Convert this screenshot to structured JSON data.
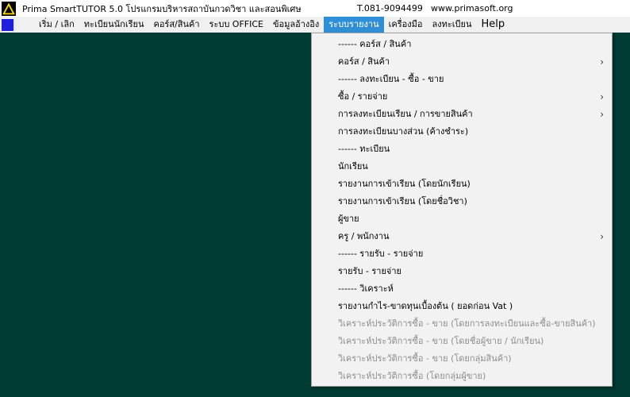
{
  "titlebar": {
    "title": "Prima  SmartTUTOR 5.0  โปรแกรมบริหารสถาบันกวดวิชา และสอนพิเศษ",
    "phone": "T.081-9094499",
    "website": "www.primasoft.org"
  },
  "menubar": {
    "items": [
      {
        "label": "เริ่ม / เลิก"
      },
      {
        "label": "ทะเบียนนักเรียน"
      },
      {
        "label": "คอร์ส/สินค้า"
      },
      {
        "label": "ระบบ OFFICE"
      },
      {
        "label": "ข้อมูลอ้างอิง"
      },
      {
        "label": "ระบบรายงาน"
      },
      {
        "label": "เครื่องมือ"
      },
      {
        "label": "ลงทะเบียน"
      },
      {
        "label": "Help"
      }
    ]
  },
  "dropdown": {
    "items": [
      {
        "label": "------  คอร์ส / สินค้า",
        "submenu": false,
        "disabled": false
      },
      {
        "label": "คอร์ส / สินค้า",
        "submenu": true,
        "disabled": false
      },
      {
        "label": "------  ลงทะเบียน - ซื้อ - ขาย",
        "submenu": false,
        "disabled": false
      },
      {
        "label": "ซื้อ / รายจ่าย",
        "submenu": true,
        "disabled": false
      },
      {
        "label": "การลงทะเบียนเรียน / การขายสินค้า",
        "submenu": true,
        "disabled": false
      },
      {
        "label": "การลงทะเบียนบางส่วน (ค้างชำระ)",
        "submenu": false,
        "disabled": false
      },
      {
        "label": "------  ทะเบียน",
        "submenu": false,
        "disabled": false
      },
      {
        "label": "นักเรียน",
        "submenu": false,
        "disabled": false
      },
      {
        "label": "รายงานการเข้าเรียน (โดยนักเรียน)",
        "submenu": false,
        "disabled": false
      },
      {
        "label": "รายงานการเข้าเรียน (โดยชื่อวิชา)",
        "submenu": false,
        "disabled": false
      },
      {
        "label": "ผู้ขาย",
        "submenu": false,
        "disabled": false
      },
      {
        "label": "ครู / พนักงาน",
        "submenu": true,
        "disabled": false
      },
      {
        "label": "------  รายรับ - รายจ่าย",
        "submenu": false,
        "disabled": false
      },
      {
        "label": "รายรับ - รายจ่าย",
        "submenu": false,
        "disabled": false
      },
      {
        "label": "------  วิเคราะห์",
        "submenu": false,
        "disabled": false
      },
      {
        "label": " รายงานกำไร-ขาดทุนเบื้องต้น ( ยอดก่อน Vat )",
        "submenu": false,
        "disabled": false
      },
      {
        "label": "วิเคราะห์ประวัติการซื้อ - ขาย (โดยการลงทะเบียนและซื้อ-ขายสินค้า)",
        "submenu": false,
        "disabled": true
      },
      {
        "label": "วิเคราะห์ประวัติการซื้อ - ขาย (โดยชื่อผู้ขาย / นักเรียน)",
        "submenu": false,
        "disabled": true
      },
      {
        "label": "วิเคราะห์ประวัติการซื้อ - ขาย (โดยกลุ่มสินค้า)",
        "submenu": false,
        "disabled": true
      },
      {
        "label": "วิเคราะห์ประวัติการซื้อ (โดยกลุ่มผู้ขาย)",
        "submenu": false,
        "disabled": true
      }
    ]
  },
  "icons": {
    "app": "warning-triangle-icon",
    "system": "system-menu-icon",
    "submenu": "chevron-right-icon"
  },
  "colors": {
    "workspace": "#003c33",
    "menu_active": "#2f8fd6",
    "system_icon": "#1f1fdc",
    "disabled_text": "#8d8d8d"
  }
}
